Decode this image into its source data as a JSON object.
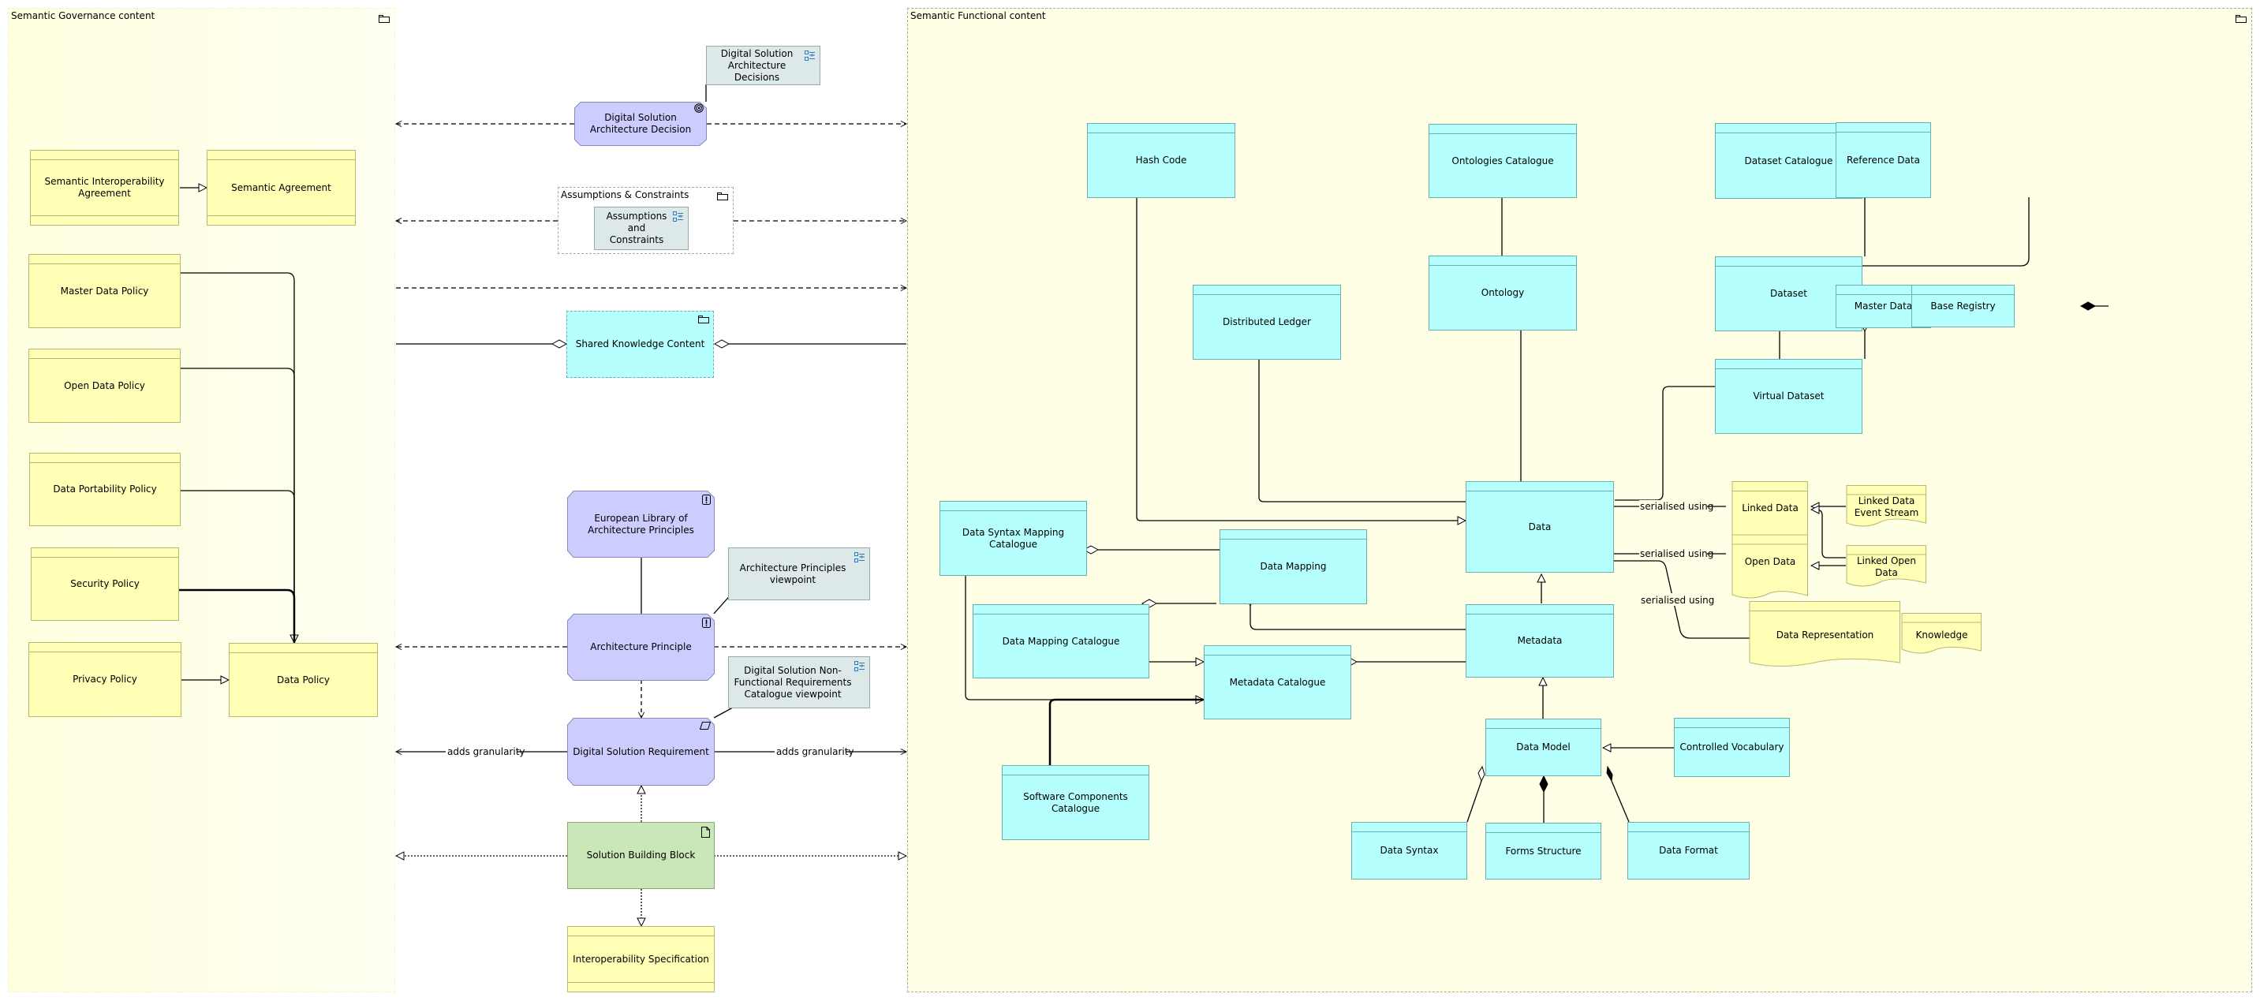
{
  "groups": {
    "governance": {
      "title": "Semantic Governance content",
      "icon": "folder-icon"
    },
    "functional": {
      "title": "Semantic Functional content",
      "icon": "folder-icon"
    },
    "assumptions": {
      "title": "Assumptions & Constraints",
      "icon": "folder-icon"
    }
  },
  "governance_nodes": {
    "semantic_interop_agreement": "Semantic Interoperability Agreement",
    "semantic_agreement": "Semantic Agreement",
    "master_data_policy": "Master Data Policy",
    "open_data_policy": "Open Data Policy",
    "data_portability_policy": "Data Portability Policy",
    "security_policy": "Security Policy",
    "privacy_policy": "Privacy Policy",
    "data_policy": "Data Policy"
  },
  "middle_nodes": {
    "dsa_decisions_viewpoint": "Digital Solution Architecture Decisions",
    "dsa_decision": "Digital Solution Architecture Decision",
    "assumptions_constraints_viewpoint": "Assumptions and Constraints",
    "shared_knowledge_content": "Shared Knowledge Content",
    "european_library": "European Library of Architecture Principles",
    "architecture_principle": "Architecture Principle",
    "arch_principles_viewpoint": "Architecture Principles viewpoint",
    "nfr_catalogue_viewpoint": "Digital Solution Non-Functional Requirements Catalogue viewpoint",
    "digital_solution_requirement": "Digital Solution Requirement",
    "solution_building_block": "Solution Building Block",
    "interoperability_specification": "Interoperability Specification"
  },
  "functional_nodes": {
    "hash_code": "Hash Code",
    "ontologies_catalogue": "Ontologies Catalogue",
    "ontology": "Ontology",
    "distributed_ledger": "Distributed Ledger",
    "dataset_catalogue": "Dataset Catalogue",
    "reference_data": "Reference Data",
    "dataset": "Dataset",
    "master_data": "Master Data",
    "base_registry": "Base Registry",
    "virtual_dataset": "Virtual Dataset",
    "data": "Data",
    "data_syntax_mapping_catalogue": "Data Syntax Mapping Catalogue",
    "data_mapping": "Data Mapping",
    "data_mapping_catalogue": "Data Mapping Catalogue",
    "metadata_catalogue": "Metadata Catalogue",
    "metadata": "Metadata",
    "software_components_catalogue": "Software Components Catalogue",
    "data_model": "Data Model",
    "controlled_vocabulary": "Controlled Vocabulary",
    "data_syntax": "Data Syntax",
    "forms_structure": "Forms Structure",
    "data_format": "Data Format",
    "linked_data": "Linked Data",
    "open_data": "Open Data",
    "linked_data_event_stream": "Linked Data Event Stream",
    "linked_open_data": "Linked Open Data",
    "data_representation": "Data Representation",
    "knowledge": "Knowledge"
  },
  "edge_labels": {
    "adds_granularity_left": "adds granularity",
    "adds_granularity_right": "adds granularity",
    "serialised_using_1": "serialised using",
    "serialised_using_2": "serialised using",
    "serialised_using_3": "serialised using"
  },
  "colors": {
    "business_object": "#ffffb5",
    "data_object": "#b5ffff",
    "motivation": "#ccccff",
    "viewpoint_ref": "#dde9e9",
    "work_package": "#c9e7b7",
    "group_bg": "#ffffe5",
    "icon_blue": "#2a7bc0"
  }
}
